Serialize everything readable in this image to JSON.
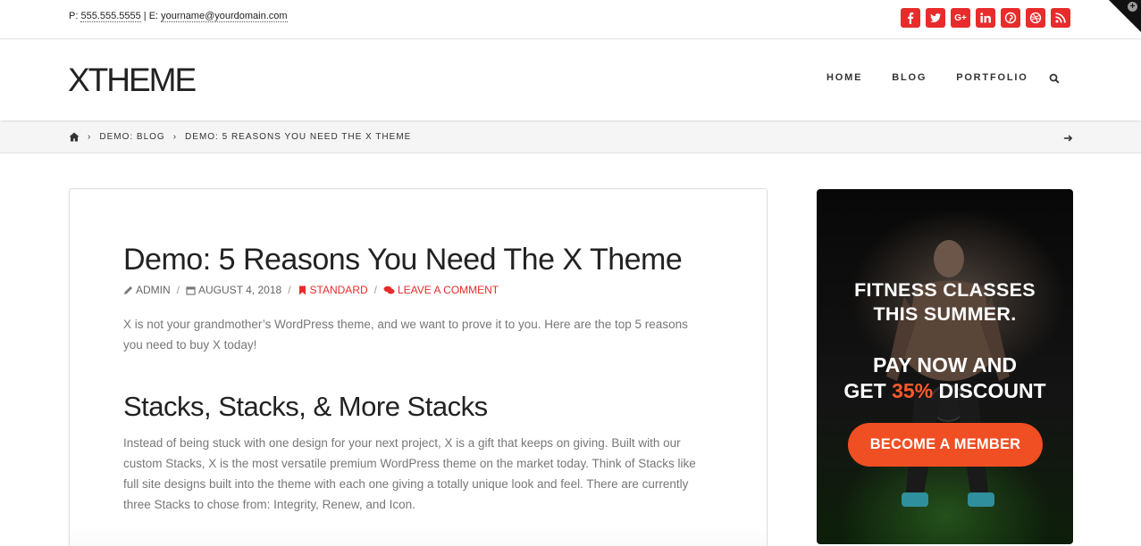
{
  "topbar": {
    "phone_prefix": "P: ",
    "phone": "555.555.5555",
    "email_prefix": " | E: ",
    "email": "yourname@yourdomain.com",
    "socials": [
      "facebook-icon",
      "twitter-icon",
      "google-plus-icon",
      "linkedin-icon",
      "pinterest-icon",
      "dribbble-icon",
      "rss-icon"
    ],
    "accent": "#e82c2c"
  },
  "header": {
    "logo": "XTHEME",
    "nav": [
      "HOME",
      "BLOG",
      "PORTFOLIO"
    ]
  },
  "breadcrumb": {
    "items": [
      "DEMO: BLOG",
      "DEMO: 5 REASONS YOU NEED THE X THEME"
    ]
  },
  "post": {
    "title": "Demo: 5 Reasons You Need The X Theme",
    "author": "ADMIN",
    "date": "AUGUST 4, 2018",
    "category": "STANDARD",
    "comment_link": "LEAVE A COMMENT",
    "intro": "X is not your grandmother’s WordPress theme, and we want to prove it to you. Here are the top 5 reasons you need to buy X today!",
    "heading": "Stacks, Stacks, & More Stacks",
    "body": "Instead of being stuck with one design for your next project, X is a gift that keeps on giving. Built with our custom Stacks, X is the most versatile premium WordPress theme on the market today. Think of Stacks like full site designs built into the theme with each one giving a totally unique look and feel. There are currently three Stacks to chose from: Integrity, Renew, and Icon."
  },
  "ad": {
    "line1a": "FITNESS CLASSES",
    "line1b": "THIS SUMMER.",
    "line2a": "PAY NOW AND",
    "line2b_pre": "GET ",
    "line2b_highlight": "35%",
    "line2b_post": " DISCOUNT",
    "button": "BECOME A MEMBER",
    "button_color": "#f04e23"
  }
}
